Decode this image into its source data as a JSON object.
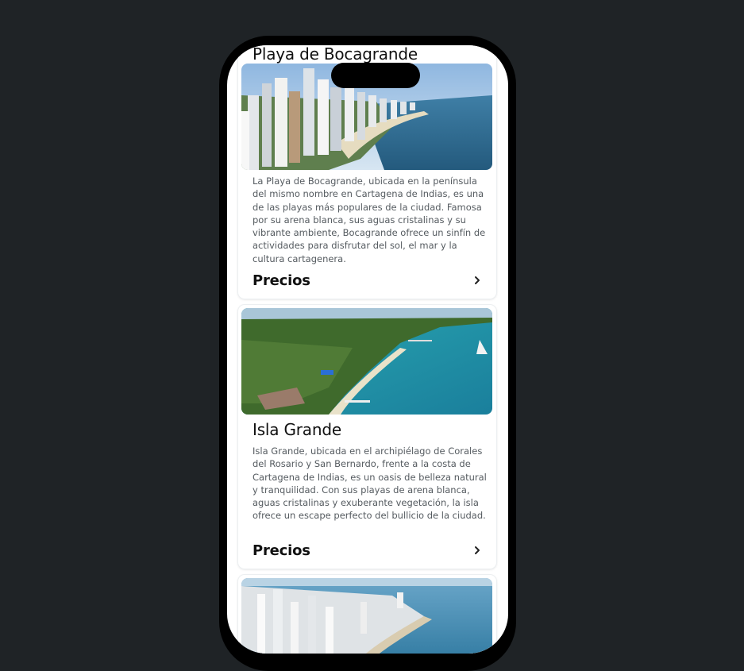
{
  "cards": [
    {
      "title": "Playa de Bocagrande",
      "description": "La Playa de Bocagrande, ubicada en la península del mismo nombre en Cartagena de Indias, es una de las playas más populares de la ciudad. Famosa por su arena blanca, sus aguas cristalinas y su vibrante ambiente, Bocagrande ofrece un sinfín de actividades para disfrutar del sol, el mar y la cultura cartagenera.",
      "price_label": "Precios"
    },
    {
      "title": "Isla Grande",
      "description": "Isla Grande, ubicada en el archipiélago de Corales del Rosario y San Bernardo, frente a la costa de Cartagena de Indias, es un oasis de belleza natural y tranquilidad. Con sus playas de arena blanca, aguas cristalinas y exuberante vegetación, la isla ofrece un escape perfecto del bullicio de la ciudad.",
      "price_label": "Precios"
    }
  ],
  "icons": {
    "price_chevron": "chevron-right-icon"
  },
  "colors": {
    "background": "#1f2326",
    "screen": "#ffffff",
    "text": "#111111",
    "muted": "#555b60"
  }
}
